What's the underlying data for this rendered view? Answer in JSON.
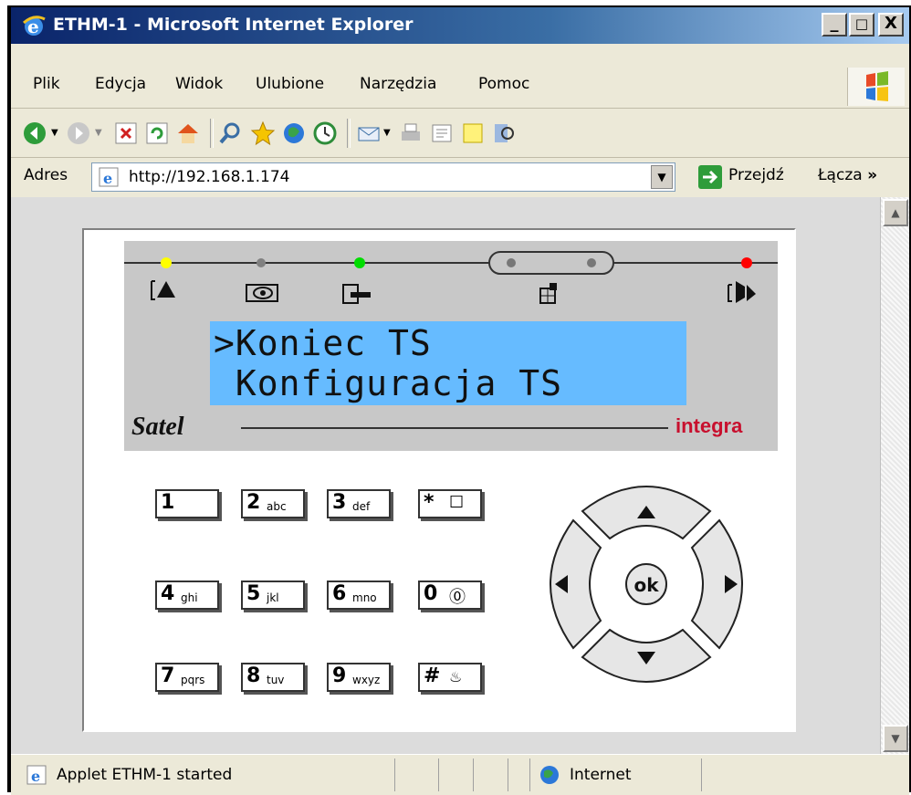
{
  "window": {
    "title": "ETHM-1 - Microsoft Internet Explorer",
    "controls": [
      "_",
      "□",
      "X"
    ]
  },
  "menu": [
    "Plik",
    "Edycja",
    "Widok",
    "Ulubione",
    "Narzędzia",
    "Pomoc"
  ],
  "toolbar": {
    "icons": [
      "back-icon",
      "forward-icon",
      "stop-icon",
      "refresh-icon",
      "home-icon",
      "search-icon",
      "favorites-icon",
      "media-icon",
      "history-icon",
      "mail-icon",
      "print-icon",
      "edit-icon",
      "discuss-icon",
      "research-icon"
    ]
  },
  "address": {
    "label": "Adres",
    "url": "http://192.168.1.174",
    "go_label": "Przejdź",
    "links_label": "Łącza",
    "chevron": "»"
  },
  "keypad": {
    "lcd_line1": ">Koniec TS",
    "lcd_line2": " Konfiguracja TS",
    "brand_left": "Satel",
    "brand_right": "integra",
    "led_colors": {
      "trouble": "#ffff00",
      "alarm_view": "#808080",
      "arm": "#00dd00",
      "alarm": "#ff0000"
    },
    "keys": [
      {
        "num": "1",
        "sub": ""
      },
      {
        "num": "2",
        "sub": "abc"
      },
      {
        "num": "3",
        "sub": "def"
      },
      {
        "num": "*",
        "sub": "☐"
      },
      {
        "num": "4",
        "sub": "ghi"
      },
      {
        "num": "5",
        "sub": "jkl"
      },
      {
        "num": "6",
        "sub": "mno"
      },
      {
        "num": "0",
        "sub": "⓪"
      },
      {
        "num": "7",
        "sub": "pqrs"
      },
      {
        "num": "8",
        "sub": "tuv"
      },
      {
        "num": "9",
        "sub": "wxyz"
      },
      {
        "num": "#",
        "sub": "♨"
      }
    ],
    "ok_label": "ok"
  },
  "status": {
    "text": "Applet ETHM-1 started",
    "zone": "Internet"
  }
}
